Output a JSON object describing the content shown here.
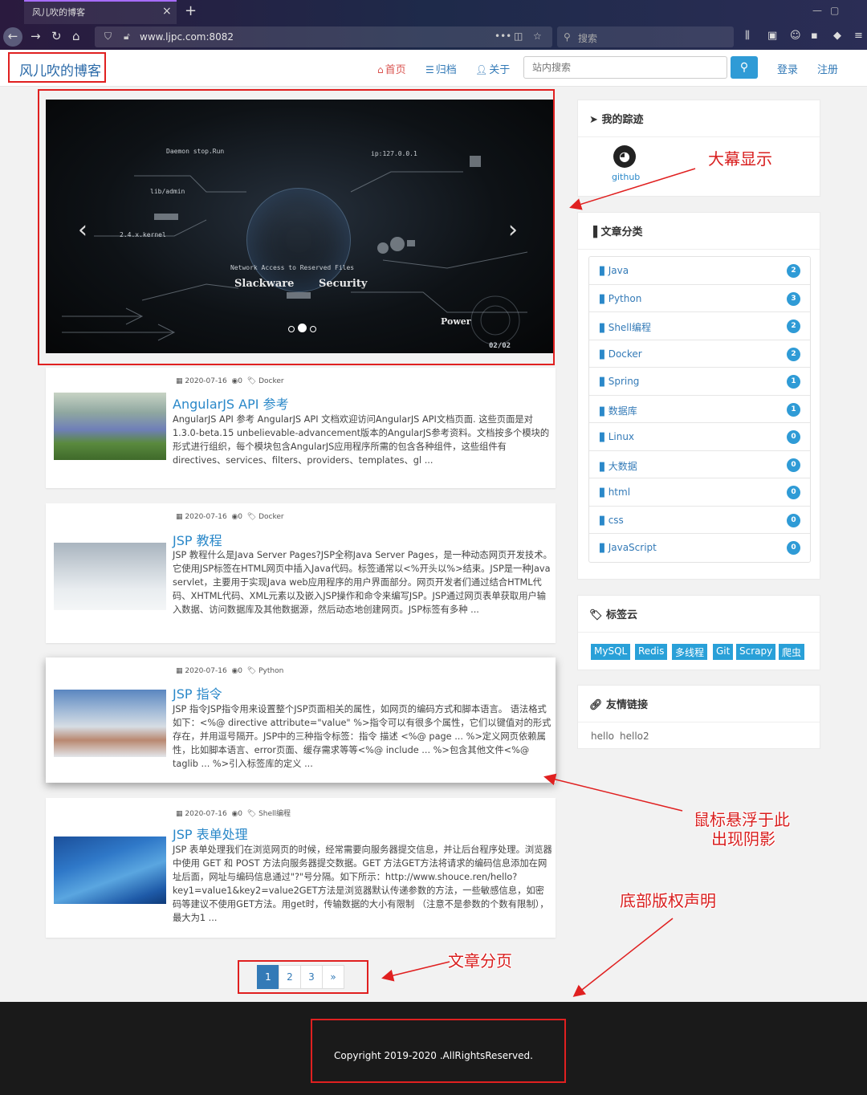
{
  "browser": {
    "tab_title": "风儿吹的博客",
    "url": "www.ljpc.com:8082",
    "search_placeholder": "搜索"
  },
  "site": {
    "brand": "风儿吹的博客",
    "nav": [
      {
        "label": "首页",
        "icon": "home-icon"
      },
      {
        "label": "归档",
        "icon": "list-icon"
      },
      {
        "label": "关于",
        "icon": "user-icon"
      }
    ],
    "search_placeholder": "站内搜索",
    "login": "登录",
    "register": "注册"
  },
  "carousel": {
    "headline_left": "Slackware",
    "headline_right": "Security",
    "power": "Power",
    "counter": "02/02",
    "kernel": "2.4.x.kernel",
    "slides": 3,
    "active_slide": 2
  },
  "posts": [
    {
      "date": "2020-07-16",
      "comments": "0",
      "category": "Docker",
      "title": "AngularJS API 参考",
      "excerpt": "AngularJS API 参考 AngularJS API 文档欢迎访问AngularJS API文档页面. 这些页面是对1.3.0-beta.15 unbelievable-advancement版本的AngularJS参考资料。文档按多个模块的形式进行组织，每个模块包含AngularJS应用程序所需的包含各种组件，这些组件有directives、services、filters、providers、templates、gl ..."
    },
    {
      "date": "2020-07-16",
      "comments": "0",
      "category": "Docker",
      "title": "JSP 教程",
      "excerpt": "JSP 教程什么是Java Server Pages?JSP全称Java Server Pages，是一种动态网页开发技术。它使用JSP标签在HTML网页中插入Java代码。标签通常以<%开头以%>结束。JSP是一种Java servlet，主要用于实现Java web应用程序的用户界面部分。网页开发者们通过结合HTML代码、XHTML代码、XML元素以及嵌入JSP操作和命令来编写JSP。JSP通过网页表单获取用户输入数据、访问数据库及其他数据源，然后动态地创建网页。JSP标签有多种 ..."
    },
    {
      "date": "2020-07-16",
      "comments": "0",
      "category": "Python",
      "title": "JSP 指令",
      "excerpt": "JSP 指令JSP指令用来设置整个JSP页面相关的属性，如网页的编码方式和脚本语言。 语法格式如下：<%@ directive attribute=\"value\" %>指令可以有很多个属性，它们以键值对的形式存在，并用逗号隔开。JSP中的三种指令标签：指令 描述 <%@ page ... %>定义网页依赖属性，比如脚本语言、error页面、缓存需求等等<%@ include ... %>包含其他文件<%@ taglib ... %>引入标签库的定义 ..."
    },
    {
      "date": "2020-07-16",
      "comments": "0",
      "category": "Shell编程",
      "title": "JSP 表单处理",
      "excerpt": "JSP 表单处理我们在浏览网页的时候，经常需要向服务器提交信息，并让后台程序处理。浏览器中使用 GET 和 POST 方法向服务器提交数据。GET 方法GET方法将请求的编码信息添加在网址后面，网址与编码信息通过\"?\"号分隔。如下所示：http://www.shouce.ren/hello?key1=value1&key2=value2GET方法是浏览器默认传递参数的方法，一些敏感信息，如密码等建议不使用GET方法。用get时，传输数据的大小有限制 （注意不是参数的个数有限制），最大为1 ..."
    }
  ],
  "sidebar": {
    "trace": {
      "title": "我的踪迹",
      "github": "github"
    },
    "categories": {
      "title": "文章分类",
      "items": [
        {
          "name": "Java",
          "count": "2"
        },
        {
          "name": "Python",
          "count": "3"
        },
        {
          "name": "Shell编程",
          "count": "2"
        },
        {
          "name": "Docker",
          "count": "2"
        },
        {
          "name": "Spring",
          "count": "1"
        },
        {
          "name": "数据库",
          "count": "1"
        },
        {
          "name": "Linux",
          "count": "0"
        },
        {
          "name": "大数据",
          "count": "0"
        },
        {
          "name": "html",
          "count": "0"
        },
        {
          "name": "css",
          "count": "0"
        },
        {
          "name": "JavaScript",
          "count": "0"
        }
      ]
    },
    "tags": {
      "title": "标签云",
      "items": [
        "MySQL",
        "Redis",
        "多线程",
        "Git",
        "Scrapy",
        "爬虫"
      ]
    },
    "links": {
      "title": "友情链接",
      "items": [
        "hello",
        "hello2"
      ]
    }
  },
  "pagination": {
    "pages": [
      "1",
      "2",
      "3"
    ],
    "next": "»",
    "active": "1"
  },
  "footer": {
    "copyright": "Copyright 2019-2020 .AllRightsReserved."
  },
  "annotations": {
    "banner": "大幕显示",
    "hover_line1": "鼠标悬浮于此",
    "hover_line2": "出现阴影",
    "footer": "底部版权声明",
    "paging": "文章分页"
  },
  "colors": {
    "brand": "#2b6aa8",
    "accent": "#2f9bd6",
    "annotation": "#e02020",
    "footer_bg": "#1a1a1a"
  }
}
